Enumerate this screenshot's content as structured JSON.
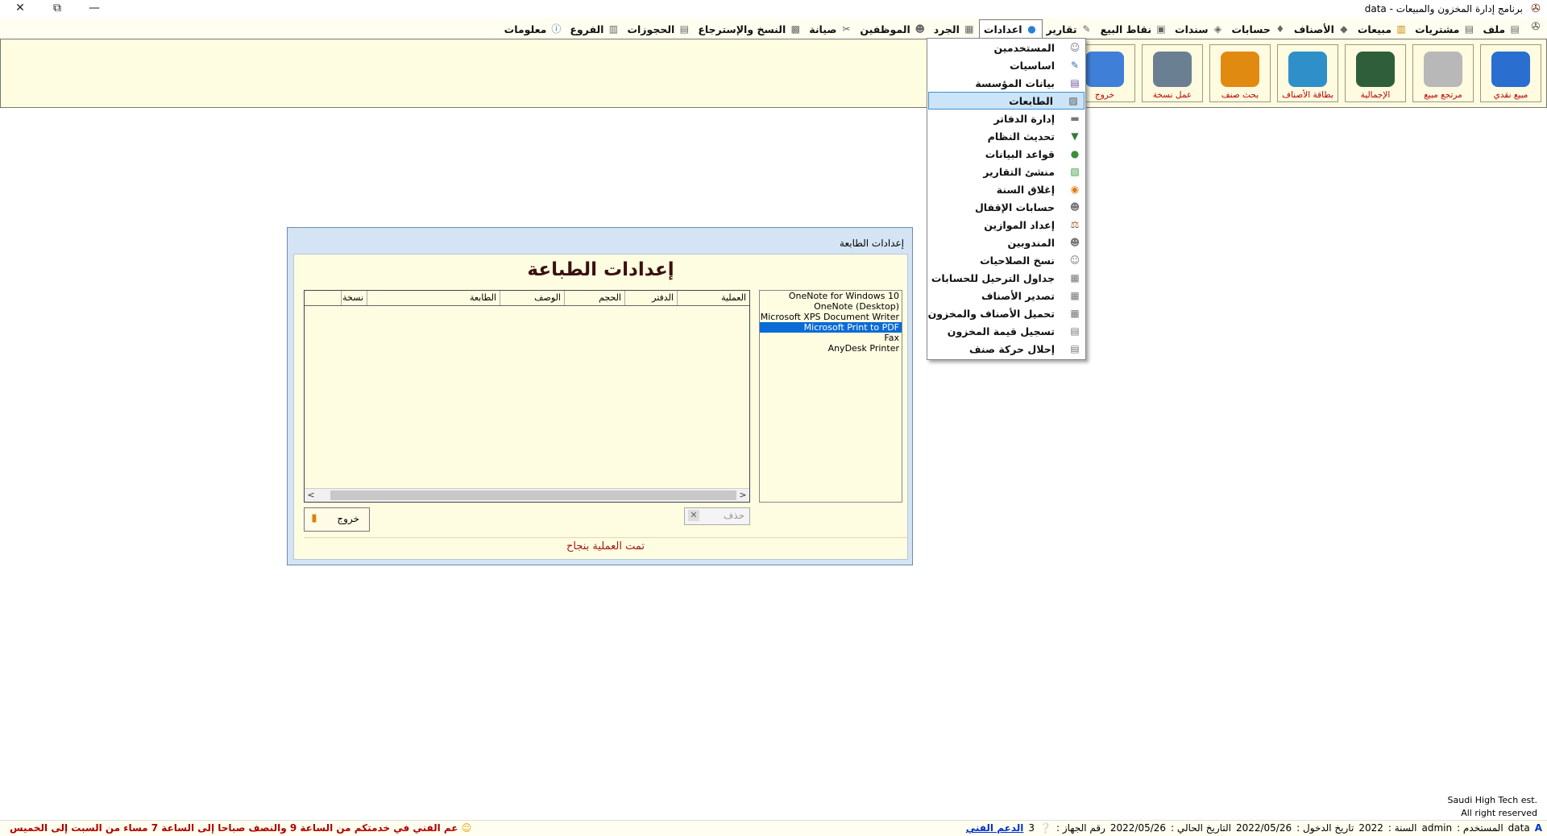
{
  "window": {
    "title": "برنامج إدارة المخزون والمبيعات - data",
    "close_label": "✕",
    "restore_label": "⧉",
    "minimize_label": "—"
  },
  "menubar": {
    "items": [
      {
        "label": "ملف",
        "icon": "file-icon"
      },
      {
        "label": "مشتريات",
        "icon": "purchases-icon"
      },
      {
        "label": "مبيعات",
        "icon": "sales-icon"
      },
      {
        "label": "الأصناف",
        "icon": "items-icon"
      },
      {
        "label": "حسابات",
        "icon": "accounts-icon"
      },
      {
        "label": "سندات",
        "icon": "vouchers-icon"
      },
      {
        "label": "نقاط البيع",
        "icon": "pos-icon"
      },
      {
        "label": "تقارير",
        "icon": "reports-icon"
      },
      {
        "label": "اعدادات",
        "icon": "settings-icon"
      },
      {
        "label": "الجرد",
        "icon": "inventory-icon"
      },
      {
        "label": "الموظفين",
        "icon": "employees-icon"
      },
      {
        "label": "صيانة",
        "icon": "maintenance-icon"
      },
      {
        "label": "النسخ والإسترجاع",
        "icon": "backup-icon"
      },
      {
        "label": "الحجوزات",
        "icon": "reservations-icon"
      },
      {
        "label": "الفروع",
        "icon": "branches-icon"
      },
      {
        "label": "معلومات",
        "icon": "info-icon"
      }
    ]
  },
  "toolbar": {
    "buttons": [
      {
        "label": "مبيع نقدي",
        "color": "#2a6fcf"
      },
      {
        "label": "مرتجع مبيع",
        "color": "#b8b8b8"
      },
      {
        "label": "الإجمالية",
        "color": "#2e5e3a"
      },
      {
        "label": "بطاقة الأصناف",
        "color": "#2f8fc9"
      },
      {
        "label": "بحث صنف",
        "color": "#e08a12"
      },
      {
        "label": "عمل نسخة",
        "color": "#6a7f92"
      },
      {
        "label": "خروج",
        "color": "#3f7fd8"
      }
    ]
  },
  "settings_menu": {
    "selected_index": 3,
    "items": [
      {
        "label": "المستخدمين",
        "icon": "users-icon"
      },
      {
        "label": "اساسيات",
        "icon": "basics-icon"
      },
      {
        "label": "بيانات المؤسسة",
        "icon": "company-data-icon"
      },
      {
        "label": "الطابعات",
        "icon": "printer-icon"
      },
      {
        "label": "إدارة الدفاتر",
        "icon": "books-icon"
      },
      {
        "label": "تحديث النظام",
        "icon": "update-icon"
      },
      {
        "label": "قواعد البيانات",
        "icon": "database-icon"
      },
      {
        "label": "منشئ التقارير",
        "icon": "report-builder-icon"
      },
      {
        "label": "إغلاق السنة",
        "icon": "close-year-icon"
      },
      {
        "label": "حسابات الإقفال",
        "icon": "closing-accounts-icon"
      },
      {
        "label": "إعداد الموازين",
        "icon": "scales-icon"
      },
      {
        "label": "المندوبين",
        "icon": "agents-icon"
      },
      {
        "label": "نسخ الصلاحيات",
        "icon": "copy-permissions-icon"
      },
      {
        "label": "جداول الترحيل للحسابات",
        "icon": "posting-tables-icon"
      },
      {
        "label": "تصدير الأصناف",
        "icon": "export-items-icon"
      },
      {
        "label": "تحميل الأصناف والمخزون",
        "icon": "load-items-icon"
      },
      {
        "label": "تسجيل قيمة المخزون",
        "icon": "stock-value-icon"
      },
      {
        "label": "إحلال حركة صنف",
        "icon": "item-movement-icon"
      }
    ]
  },
  "dialog": {
    "title": "إعدادات الطابعة",
    "heading": "إعدادات الطباعة",
    "printers": [
      "OneNote for Windows 10",
      "OneNote (Desktop)",
      "Microsoft XPS Document Writer",
      "Microsoft Print to PDF",
      "Fax",
      "AnyDesk Printer"
    ],
    "selected_printer": "Microsoft Print to PDF",
    "columns": [
      "العملية",
      "الدفتر",
      "الحجم",
      "الوصف",
      "الطابعة",
      "نسخة"
    ],
    "rows": [],
    "delete_label": "حذف",
    "exit_label": "خروج",
    "status": "تمت العملية بنجاح"
  },
  "footer": {
    "company": "Saudi High Tech est.",
    "rights": "All right reserved"
  },
  "statusbar": {
    "badge": "A",
    "db": "data",
    "user_label": "المستخدم :",
    "user": "admin",
    "year_label": "السنة :",
    "year": "2022",
    "login_label": "تاريخ الدخول :",
    "login_date": "2022/05/26",
    "current_label": "التاريخ الحالي :",
    "current_date": "2022/05/26",
    "device_label": "رقم الجهاز :",
    "device": "3",
    "support": "الدعم الفني",
    "support_msg": "عم الفني في خدمتكم من الساعة 9 والنصف صباحا إلى الساعة 7 مساء من السبت إلى الخميس"
  }
}
